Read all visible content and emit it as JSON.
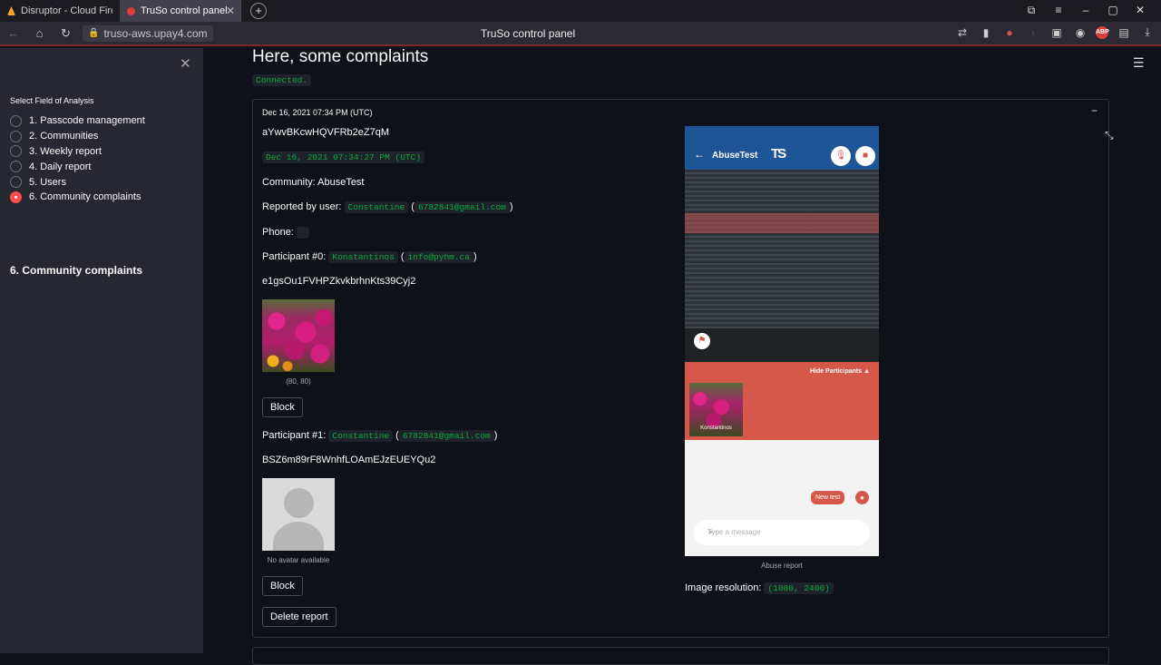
{
  "browser": {
    "tabs": [
      {
        "title": "Disruptor - Cloud Firestore"
      },
      {
        "title": "TruSo control panel"
      }
    ],
    "url": "truso-aws.upay4.com",
    "page_title": "TruSo control panel",
    "ext_abp": "ABP"
  },
  "sidebar": {
    "label": "Select Field of Analysis",
    "options": [
      "1. Passcode management",
      "2. Communities",
      "3. Weekly report",
      "4. Daily report",
      "5. Users",
      "6. Community complaints"
    ],
    "selected_index": 5,
    "heading": "6. Community complaints"
  },
  "main": {
    "title": "Here, some complaints",
    "status": "Connected.",
    "report": {
      "header": "Dec 16, 2021 07:34 PM (UTC)",
      "id": "aYwvBKcwHQVFRb2eZ7qM",
      "timestamp": "Dec 16, 2021 07:34:27 PM (UTC)",
      "community": "Community: AbuseTest",
      "reported_by_label": "Reported by user:",
      "reported_by_name": "Constantine",
      "reported_by_email": "6782841@gmail.com",
      "phone_label": "Phone:",
      "participants": [
        {
          "label": "Participant #0:",
          "name": "Konstantinos",
          "email": "info@pyhm.ca",
          "uid": "e1gsOu1FVHPZkvkbrhnKts39Cyj2",
          "caption": "(80, 80)",
          "block_label": "Block"
        },
        {
          "label": "Participant #1:",
          "name": "Constantine",
          "email": "6782841@gmail.com",
          "uid": "BSZ6m89rF8WnhfLOAmEJzEUEYQu2",
          "caption": "No avatar available",
          "block_label": "Block"
        }
      ],
      "delete_label": "Delete report",
      "screenshot_caption": "Abuse report",
      "resolution_label": "Image resolution:",
      "resolution_value": "(1080, 2400)"
    }
  },
  "phone": {
    "title": "AbuseTest",
    "logo": "TS",
    "hide_participants": "Hide Participants",
    "participant_name": "Konstantinos",
    "message": "New test",
    "input_placeholder": "Type a message"
  }
}
